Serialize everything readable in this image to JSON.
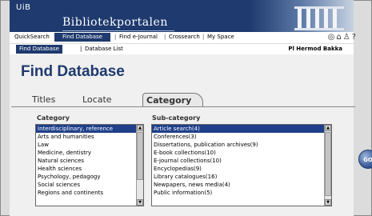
{
  "header": {
    "logo_text": "UiB",
    "portal_title": "Bibliotekportalen"
  },
  "top_nav": {
    "items": [
      "QuickSearch",
      "Find Database",
      "Find e-Journal",
      "Crossearch",
      "My Space"
    ],
    "separator": "|",
    "active_index": 1,
    "icons": [
      "globe-icon",
      "library-icon",
      "user-icon",
      "help-icon"
    ]
  },
  "sub_nav": {
    "items": [
      "Find Database",
      "Database List"
    ],
    "active_index": 0,
    "user_name": "Pl Hermod Bakka"
  },
  "page": {
    "title": "Find Database"
  },
  "tabs": {
    "items": [
      "Titles",
      "Locate",
      "Category"
    ],
    "active_index": 2
  },
  "category": {
    "label": "Category",
    "items": [
      "Interdisciplinary, reference",
      "Arts and humanities",
      "Law",
      "Medicine, dentistry",
      "Natural sciences",
      "Health sciences",
      "Psychology, pedagogy",
      "Social sciences",
      "Regions and continents"
    ],
    "selected_index": 0
  },
  "subcategory": {
    "label": "Sub-category",
    "items": [
      "Article search(4)",
      "Conferences(3)",
      "Dissertations, publication archives(9)",
      "E-book collections(10)",
      "E-journal collections(10)",
      "Encyclopedias(9)",
      "Library catalogues(16)",
      "Newpapers, news media(4)",
      "Public information(5)"
    ],
    "selected_index": 0
  },
  "go_button": {
    "label": "GO"
  },
  "colors": {
    "brand_navy": "#1e3a6e",
    "selection_blue": "#1f3f8a",
    "content_bg": "#f0f0f0"
  }
}
